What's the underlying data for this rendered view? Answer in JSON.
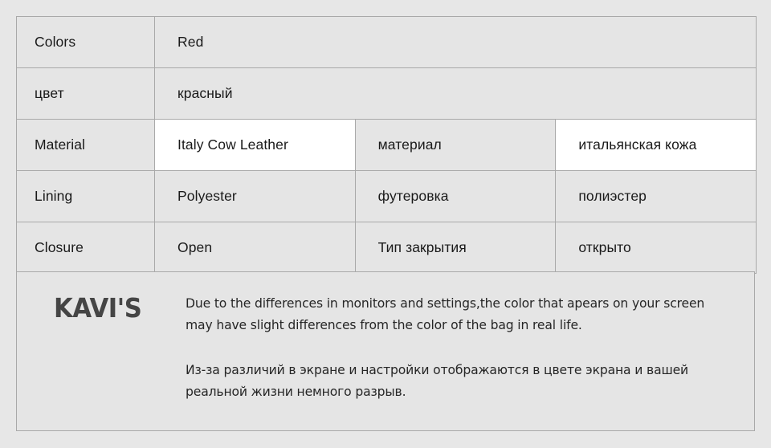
{
  "page": {
    "background_color": "#e7e7e7",
    "table_border_color": "#a9a9a9",
    "cell_background": "#e5e5e5",
    "highlight_background": "#ffffff",
    "text_color": "#1a1a1a"
  },
  "spec_table": {
    "rows": [
      {
        "label": "Colors",
        "value": "Red",
        "label_ru": null,
        "value_ru": null,
        "full_width": true,
        "highlight_value": false,
        "highlight_value_ru": false
      },
      {
        "label": "цвет",
        "value": "красный",
        "label_ru": null,
        "value_ru": null,
        "full_width": true,
        "highlight_value": false,
        "highlight_value_ru": false
      },
      {
        "label": "Material",
        "value": "Italy Cow Leather",
        "label_ru": "материал",
        "value_ru": "итальянская кожа",
        "full_width": false,
        "highlight_value": true,
        "highlight_value_ru": true
      },
      {
        "label": "Lining",
        "value": "Polyester",
        "label_ru": "футеровка",
        "value_ru": "полиэстер",
        "full_width": false,
        "highlight_value": false,
        "highlight_value_ru": false
      },
      {
        "label": "Closure",
        "value": "Open",
        "label_ru": "Тип закрытия",
        "value_ru": "открыто",
        "full_width": false,
        "highlight_value": false,
        "highlight_value_ru": false
      }
    ]
  },
  "footer": {
    "brand": "KAVI'S",
    "brand_color": "#454545",
    "disclaimer_en": "Due to the differences in monitors and settings,the color that apears on your screen may have slight differences from the color of the bag in real life.",
    "disclaimer_ru": "Из-за различий в экране и настройки отображаются в цвете экрана и вашей реальной жизни немного разрыв."
  }
}
